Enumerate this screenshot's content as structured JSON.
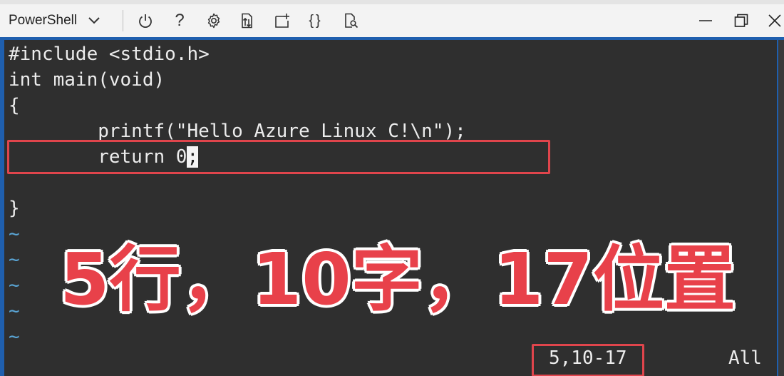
{
  "titlebar": {
    "shell_label": "PowerShell",
    "tools": [
      {
        "name": "power-icon"
      },
      {
        "name": "help-icon",
        "glyph": "?"
      },
      {
        "name": "settings-icon"
      },
      {
        "name": "upload-download-icon"
      },
      {
        "name": "new-session-icon"
      },
      {
        "name": "braces-icon",
        "glyph": "{}"
      },
      {
        "name": "web-preview-icon"
      }
    ],
    "window_controls": [
      "minimize-icon",
      "restore-icon",
      "close-icon"
    ]
  },
  "editor": {
    "lines": [
      "#include <stdio.h>",
      "int main(void)",
      "{",
      "        printf(\"Hello Azure Linux C!\\n\");",
      "        return 0",
      "",
      "}"
    ],
    "cursor_char": ";",
    "tilde": "~",
    "status_position": "5,10-17",
    "status_scroll": "All"
  },
  "overlay_text": "5行，10字，17位置",
  "colors": {
    "terminal_bg": "#2f2f2f",
    "accent": "#1f5fae",
    "highlight_red": "#e0454c",
    "tilde_blue": "#5aa6d6",
    "overlay_red": "#e8414a"
  }
}
